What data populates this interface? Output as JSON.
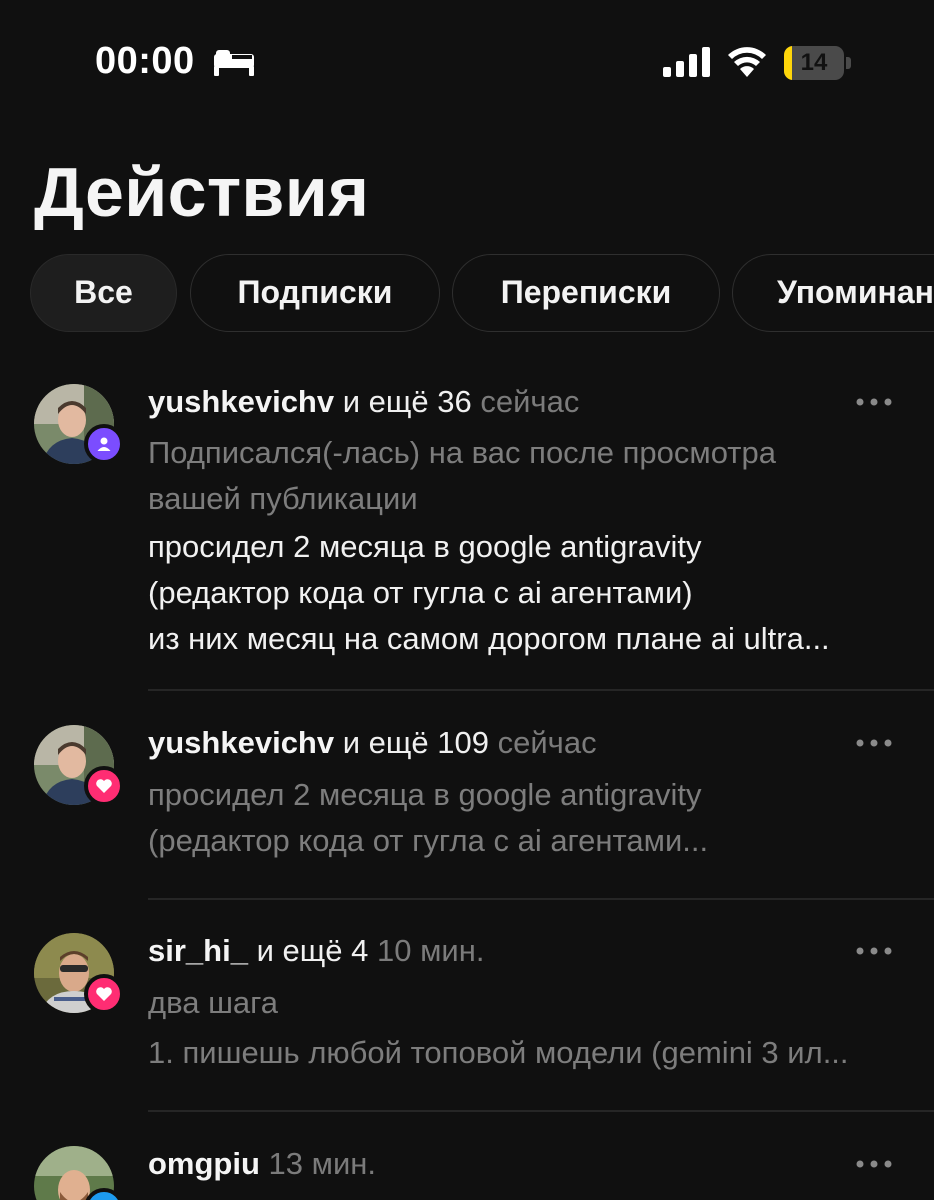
{
  "status_bar": {
    "time": "00:00",
    "battery_level": "14",
    "battery_fraction": 0.14,
    "icons": [
      "bed-icon",
      "cellular-signal-icon",
      "wifi-icon",
      "battery-icon"
    ]
  },
  "page": {
    "title": "Действия"
  },
  "tabs": [
    {
      "label": "Все",
      "active": true
    },
    {
      "label": "Подписки",
      "active": false
    },
    {
      "label": "Переписки",
      "active": false
    },
    {
      "label": "Упоминан",
      "active": false
    }
  ],
  "feed": [
    {
      "username": "yushkevichv",
      "others": "и ещё 36",
      "time": "сейчас",
      "badge": "person-icon",
      "badge_color": "#7b4dff",
      "lines": [
        {
          "text": "Подписался(-лась) на вас после просмотра",
          "style": "muted"
        },
        {
          "text": "вашей публикации",
          "style": "muted"
        },
        {
          "text": "просидел 2 месяца в google antigravity",
          "style": "bright"
        },
        {
          "text": "(редактор кода от гугла с ai агентами)",
          "style": "bright"
        },
        {
          "text": "из них месяц на самом дорогом плане ai ultra...",
          "style": "bright"
        }
      ]
    },
    {
      "username": "yushkevichv",
      "others": "и ещё 109",
      "time": "сейчас",
      "badge": "heart-icon",
      "badge_color": "#ff2d73",
      "lines": [
        {
          "text": "просидел 2 месяца в google antigravity",
          "style": "muted"
        },
        {
          "text": "(редактор кода от гугла с ai агентами...",
          "style": "muted"
        }
      ]
    },
    {
      "username": "sir_hi_",
      "others": "и ещё 4",
      "time": "10 мин.",
      "badge": "heart-icon",
      "badge_color": "#ff2d73",
      "lines": [
        {
          "text": "два шага",
          "style": "muted"
        },
        {
          "text": "1. пишешь любой топовой модели (gemini 3 ил...",
          "style": "muted"
        }
      ]
    },
    {
      "username": "omgpiu",
      "others": "",
      "time": "13 мин.",
      "badge": "reply-icon",
      "badge_color": "#1d9bf0",
      "lines": []
    }
  ]
}
